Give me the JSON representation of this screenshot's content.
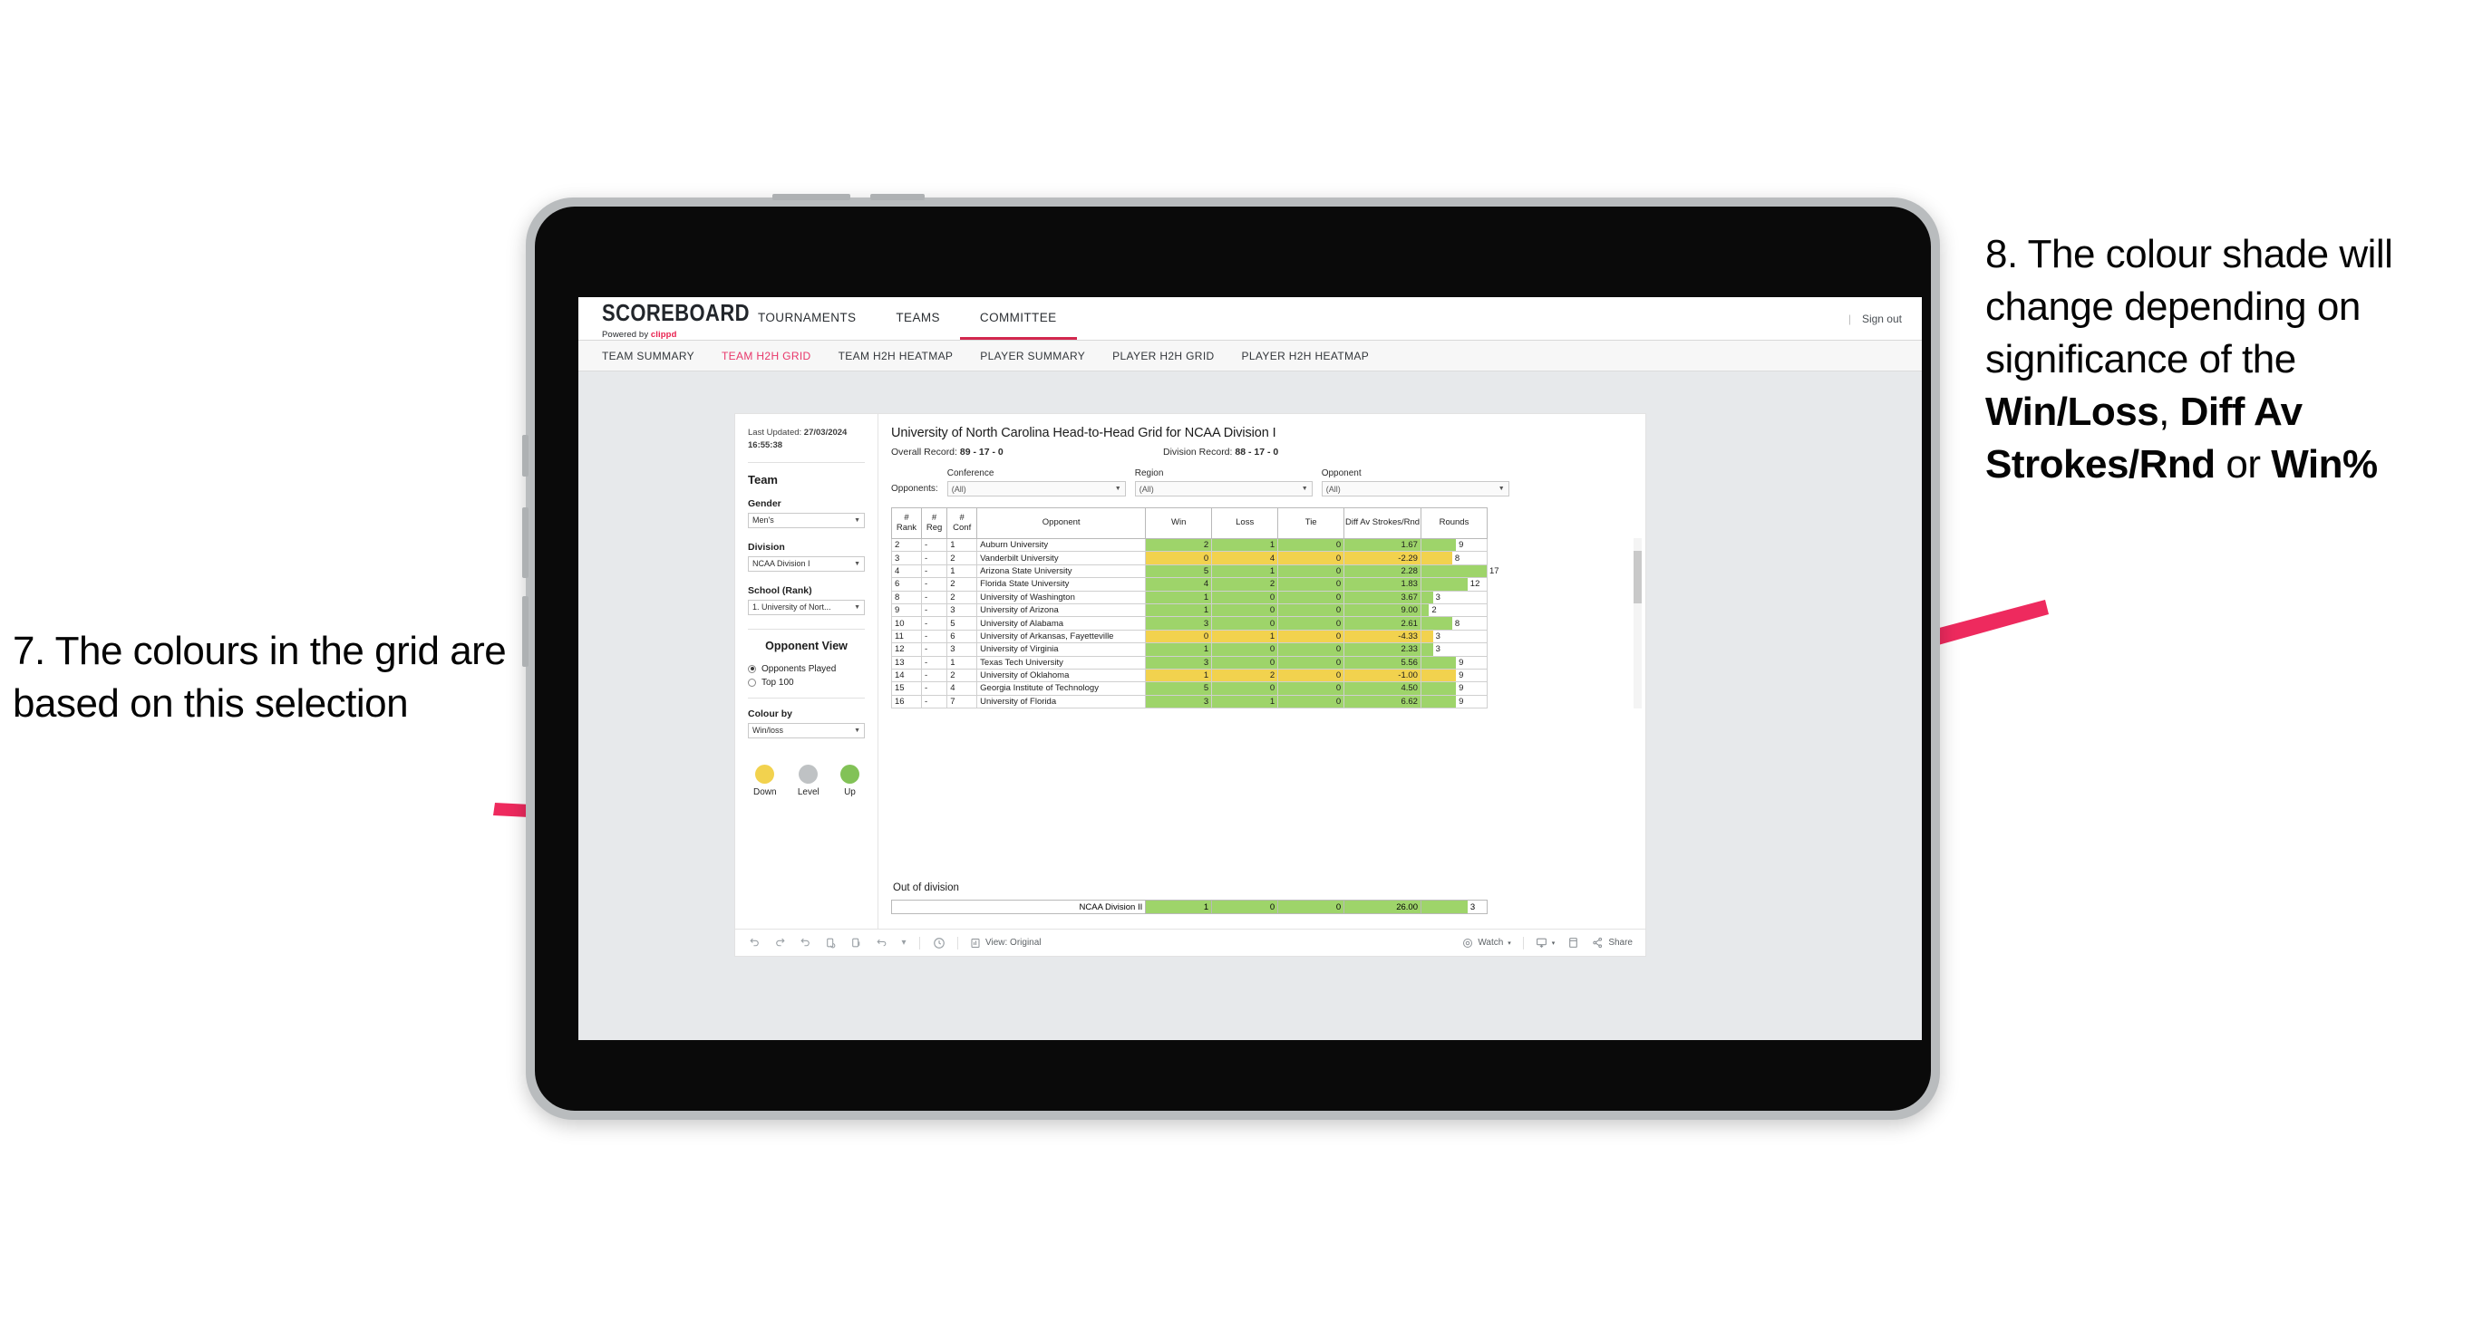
{
  "annotations": {
    "left": {
      "num": "7.",
      "text": "The colours in the grid are based on this selection"
    },
    "right": {
      "part1": "8. The colour shade will change depending on significance of the ",
      "bold1": "Win/Loss",
      "mid1": ", ",
      "bold2": "Diff Av Strokes/Rnd",
      "mid2": " or ",
      "bold3": "Win%"
    },
    "arrow_color": "#EE2A5E"
  },
  "app": {
    "brand": {
      "title": "SCOREBOARD",
      "powered_prefix": "Powered by ",
      "powered_brand": "clippd"
    },
    "top_nav": [
      {
        "label": "TOURNAMENTS",
        "active": false
      },
      {
        "label": "TEAMS",
        "active": false
      },
      {
        "label": "COMMITTEE",
        "active": true
      }
    ],
    "header_right": {
      "divider": "|",
      "sign_out": "Sign out"
    },
    "sub_nav": [
      {
        "label": "TEAM SUMMARY",
        "active": false
      },
      {
        "label": "TEAM H2H GRID",
        "active": true
      },
      {
        "label": "TEAM H2H HEATMAP",
        "active": false
      },
      {
        "label": "PLAYER SUMMARY",
        "active": false
      },
      {
        "label": "PLAYER H2H GRID",
        "active": false
      },
      {
        "label": "PLAYER H2H HEATMAP",
        "active": false
      }
    ],
    "accent": "#D2284E",
    "active_tab_color": "#E8376A"
  },
  "sidebar": {
    "updated_label": "Last Updated: ",
    "updated_value": "27/03/2024 16:55:38",
    "team_heading": "Team",
    "fields": [
      {
        "label": "Gender",
        "value": "Men's"
      },
      {
        "label": "Division",
        "value": "NCAA Division I"
      },
      {
        "label": "School (Rank)",
        "value": "1. University of Nort..."
      }
    ],
    "opponent_view": {
      "heading": "Opponent View",
      "options": [
        {
          "label": "Opponents Played",
          "selected": true
        },
        {
          "label": "Top 100",
          "selected": false
        }
      ]
    },
    "colour_by": {
      "label": "Colour by",
      "value": "Win/loss"
    },
    "legend": [
      {
        "label": "Down",
        "color": "#F2D24E"
      },
      {
        "label": "Level",
        "color": "#BFC2C4"
      },
      {
        "label": "Up",
        "color": "#82C257"
      }
    ]
  },
  "main": {
    "title": "University of North Carolina Head-to-Head Grid for NCAA Division I",
    "overall_record_label": "Overall Record: ",
    "overall_record_value": "89 - 17 - 0",
    "division_record_label": "Division Record: ",
    "division_record_value": "88 - 17 - 0",
    "opponents_label": "Opponents:",
    "filters": [
      {
        "caption": "Conference",
        "value": "(All)"
      },
      {
        "caption": "Region",
        "value": "(All)"
      },
      {
        "caption": "Opponent",
        "value": "(All)"
      }
    ],
    "out_of_division_title": "Out of division"
  },
  "chart_data": {
    "type": "table",
    "title": "University of North Carolina Head-to-Head Grid for NCAA Division I",
    "columns": [
      "# Rank",
      "# Reg",
      "# Conf",
      "Opponent",
      "Win",
      "Loss",
      "Tie",
      "Diff Av Strokes/Rnd",
      "Rounds"
    ],
    "colour_scheme": {
      "up": "#9ED46A",
      "down": "#F2D24E",
      "level": "#BFC2C4"
    },
    "rounds_max": 17,
    "rows": [
      {
        "rank": "2",
        "reg": "-",
        "conf": "1",
        "opponent": "Auburn University",
        "win": 2,
        "loss": 1,
        "tie": 0,
        "diff": "1.67",
        "rounds": 9,
        "state": "up"
      },
      {
        "rank": "3",
        "reg": "-",
        "conf": "2",
        "opponent": "Vanderbilt University",
        "win": 0,
        "loss": 4,
        "tie": 0,
        "diff": "-2.29",
        "rounds": 8,
        "state": "down"
      },
      {
        "rank": "4",
        "reg": "-",
        "conf": "1",
        "opponent": "Arizona State University",
        "win": 5,
        "loss": 1,
        "tie": 0,
        "diff": "2.28",
        "rounds": 17,
        "state": "up"
      },
      {
        "rank": "6",
        "reg": "-",
        "conf": "2",
        "opponent": "Florida State University",
        "win": 4,
        "loss": 2,
        "tie": 0,
        "diff": "1.83",
        "rounds": 12,
        "state": "up"
      },
      {
        "rank": "8",
        "reg": "-",
        "conf": "2",
        "opponent": "University of Washington",
        "win": 1,
        "loss": 0,
        "tie": 0,
        "diff": "3.67",
        "rounds": 3,
        "state": "up"
      },
      {
        "rank": "9",
        "reg": "-",
        "conf": "3",
        "opponent": "University of Arizona",
        "win": 1,
        "loss": 0,
        "tie": 0,
        "diff": "9.00",
        "rounds": 2,
        "state": "up"
      },
      {
        "rank": "10",
        "reg": "-",
        "conf": "5",
        "opponent": "University of Alabama",
        "win": 3,
        "loss": 0,
        "tie": 0,
        "diff": "2.61",
        "rounds": 8,
        "state": "up"
      },
      {
        "rank": "11",
        "reg": "-",
        "conf": "6",
        "opponent": "University of Arkansas, Fayetteville",
        "win": 0,
        "loss": 1,
        "tie": 0,
        "diff": "-4.33",
        "rounds": 3,
        "state": "down"
      },
      {
        "rank": "12",
        "reg": "-",
        "conf": "3",
        "opponent": "University of Virginia",
        "win": 1,
        "loss": 0,
        "tie": 0,
        "diff": "2.33",
        "rounds": 3,
        "state": "up"
      },
      {
        "rank": "13",
        "reg": "-",
        "conf": "1",
        "opponent": "Texas Tech University",
        "win": 3,
        "loss": 0,
        "tie": 0,
        "diff": "5.56",
        "rounds": 9,
        "state": "up"
      },
      {
        "rank": "14",
        "reg": "-",
        "conf": "2",
        "opponent": "University of Oklahoma",
        "win": 1,
        "loss": 2,
        "tie": 0,
        "diff": "-1.00",
        "rounds": 9,
        "state": "down"
      },
      {
        "rank": "15",
        "reg": "-",
        "conf": "4",
        "opponent": "Georgia Institute of Technology",
        "win": 5,
        "loss": 0,
        "tie": 0,
        "diff": "4.50",
        "rounds": 9,
        "state": "up"
      },
      {
        "rank": "16",
        "reg": "-",
        "conf": "7",
        "opponent": "University of Florida",
        "win": 3,
        "loss": 1,
        "tie": 0,
        "diff": "6.62",
        "rounds": 9,
        "state": "up"
      }
    ],
    "out_of_division": [
      {
        "opponent": "NCAA Division II",
        "win": 1,
        "loss": 0,
        "tie": 0,
        "diff": "26.00",
        "rounds": 3,
        "state": "up"
      }
    ]
  },
  "toolbar": {
    "view_label": "View: Original",
    "watch_label": "Watch",
    "share_label": "Share"
  }
}
